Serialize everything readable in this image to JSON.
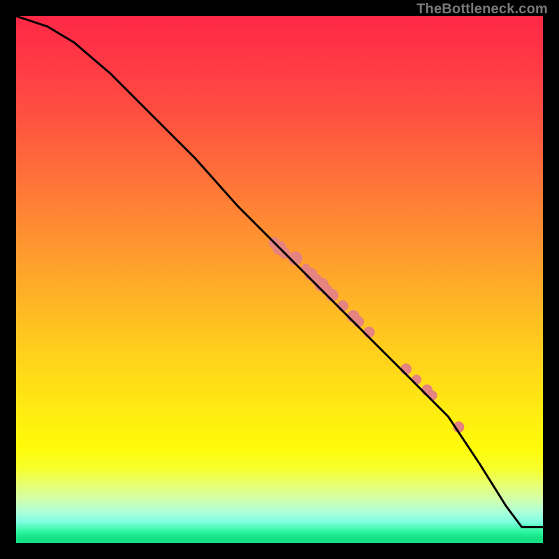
{
  "watermark": "TheBottleneck.com",
  "chart_data": {
    "type": "line",
    "title": "",
    "xlabel": "",
    "ylabel": "",
    "xlim": [
      0,
      100
    ],
    "ylim": [
      0,
      100
    ],
    "series": [
      {
        "name": "curve",
        "x": [
          0,
          3,
          6,
          11,
          18,
          26,
          34,
          42,
          50,
          58,
          66,
          74,
          82,
          88,
          93,
          96,
          100
        ],
        "y": [
          100,
          99,
          98,
          95,
          89,
          81,
          73,
          64,
          56,
          48,
          40,
          32,
          24,
          15,
          7,
          3,
          3
        ]
      }
    ],
    "scatter": {
      "name": "highlighted-points",
      "x": [
        49,
        50,
        51,
        53,
        55,
        56,
        57,
        58,
        59,
        60,
        62,
        64,
        65,
        67,
        74,
        76,
        78,
        79,
        84
      ],
      "y": [
        57,
        56,
        55,
        54,
        52,
        51,
        50,
        49,
        48,
        47,
        45,
        43,
        42,
        40,
        33,
        31,
        29,
        28,
        22
      ],
      "r": [
        8,
        10,
        8,
        10,
        7,
        9,
        8,
        10,
        8,
        9,
        8,
        9,
        8,
        8,
        8,
        7,
        8,
        7,
        8
      ]
    },
    "colors": {
      "curve": "#000000",
      "points": "#e58380"
    }
  }
}
